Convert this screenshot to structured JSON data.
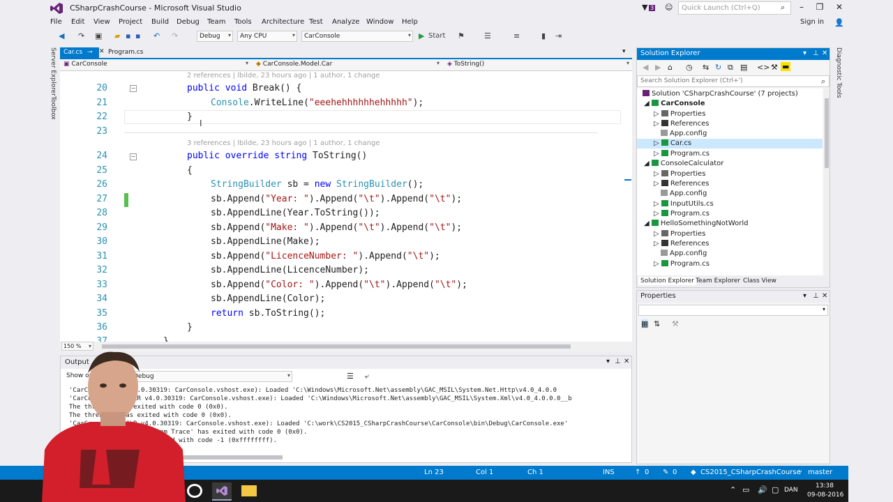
{
  "window": {
    "title": "CSharpCrashCourse - Microsoft Visual Studio",
    "notifications": "3",
    "quick_launch_placeholder": "Quick Launch (Ctrl+Q)",
    "signin": "Sign in"
  },
  "menu": [
    "File",
    "Edit",
    "View",
    "Project",
    "Build",
    "Debug",
    "Team",
    "Tools",
    "Architecture",
    "Test",
    "Analyze",
    "Window",
    "Help"
  ],
  "toolbar": {
    "config": "Debug",
    "platform": "Any CPU",
    "project": "CarConsole",
    "start": "Start"
  },
  "side_left": [
    "Server Explorer",
    "Toolbox"
  ],
  "side_right": [
    "Diagnostic Tools"
  ],
  "editor": {
    "tabs": [
      {
        "label": "Car.cs",
        "active": true
      },
      {
        "label": "Program.cs",
        "active": false
      }
    ],
    "nav": [
      "CarConsole",
      "CarConsole.Model.Car",
      "ToString()"
    ],
    "codelens": [
      "2 references | lbilde, 23 hours ago | 1 author, 1 change",
      "3 references | lbilde, 23 hours ago | 1 author, 1 change"
    ],
    "lines": [
      {
        "n": "20",
        "code": "public void Break() {"
      },
      {
        "n": "21",
        "code": "Console.WriteLine(\"eeehehhhhhhehhhhh\");"
      },
      {
        "n": "22",
        "code": "}"
      },
      {
        "n": "23",
        "code": ""
      },
      {
        "n": "24",
        "code": "public override string ToString()"
      },
      {
        "n": "25",
        "code": "{"
      },
      {
        "n": "26",
        "code": "StringBuilder sb = new StringBuilder();"
      },
      {
        "n": "27",
        "code": "sb.Append(\"Year: \").Append(\"\\t\").Append(\"\\t\");"
      },
      {
        "n": "28",
        "code": "sb.AppendLine(Year.ToString());"
      },
      {
        "n": "29",
        "code": "sb.Append(\"Make: \").Append(\"\\t\").Append(\"\\t\");"
      },
      {
        "n": "30",
        "code": "sb.AppendLine(Make);"
      },
      {
        "n": "31",
        "code": "sb.Append(\"LicenceNumber: \").Append(\"\\t\");"
      },
      {
        "n": "32",
        "code": "sb.AppendLine(LicenceNumber);"
      },
      {
        "n": "33",
        "code": "sb.Append(\"Color: \").Append(\"\\t\").Append(\"\\t\");"
      },
      {
        "n": "34",
        "code": "sb.AppendLine(Color);"
      },
      {
        "n": "35",
        "code": "return sb.ToString();"
      },
      {
        "n": "36",
        "code": "}"
      },
      {
        "n": "37",
        "code": "}"
      }
    ],
    "zoom": "150 %"
  },
  "output": {
    "title": "Output",
    "show_from_label": "Show output from:",
    "show_from_value": "Debug",
    "lines": [
      "'CarCon... (CLR v4.0.30319: CarConsole.vshost.exe): Loaded 'C:\\Windows\\Microsoft.Net\\assembly\\GAC_MSIL\\System.Net.Http\\v4.0_4.0.0",
      "'CarCon...exe' (CLR v4.0.30319: CarConsole.vshost.exe): Loaded 'C:\\Windows\\Microsoft.Net\\assembly\\GAC_MSIL\\System.Xml\\v4.0_4.0.0.0__b",
      "The thre...8 has exited with code 0 (0x0).",
      "The threa...8 has exited with code 0 (0x0).",
      "'CarCo...exe' (CLR v4.0.30319: CarConsole.vshost.exe): Loaded 'C:\\work\\CS2015_CSharpCrashCourse\\CarConsole\\bin\\Debug\\CarConsole.exe'",
      "...ole.vshost.exe: Program Trace' has exited with code 0 (0x0).",
      "...le.vshost.exe' has exited with code -1 (0xffffffff)."
    ]
  },
  "solution_explorer": {
    "title": "Solution Explorer",
    "search_placeholder": "Search Solution Explorer (Ctrl+')",
    "items": [
      {
        "label": "Solution 'CSharpCrashCourse' (7 projects)",
        "indent": 0,
        "bold": false
      },
      {
        "label": "CarConsole",
        "indent": 1,
        "bold": true
      },
      {
        "label": "Properties",
        "indent": 2,
        "bold": false
      },
      {
        "label": "References",
        "indent": 2,
        "bold": false
      },
      {
        "label": "App.config",
        "indent": 2,
        "bold": false
      },
      {
        "label": "Car.cs",
        "indent": 2,
        "bold": false,
        "selected": true
      },
      {
        "label": "Program.cs",
        "indent": 2,
        "bold": false
      },
      {
        "label": "ConsoleCalculator",
        "indent": 1,
        "bold": false
      },
      {
        "label": "Properties",
        "indent": 2,
        "bold": false
      },
      {
        "label": "References",
        "indent": 2,
        "bold": false
      },
      {
        "label": "App.config",
        "indent": 2,
        "bold": false
      },
      {
        "label": "InputUtils.cs",
        "indent": 2,
        "bold": false
      },
      {
        "label": "Program.cs",
        "indent": 2,
        "bold": false
      },
      {
        "label": "HelloSomethingNotWorld",
        "indent": 1,
        "bold": false
      },
      {
        "label": "Properties",
        "indent": 2,
        "bold": false
      },
      {
        "label": "References",
        "indent": 2,
        "bold": false
      },
      {
        "label": "App.config",
        "indent": 2,
        "bold": false
      },
      {
        "label": "Program.cs",
        "indent": 2,
        "bold": false
      }
    ],
    "bottom_tabs": [
      "Solution Explorer",
      "Team Explorer",
      "Class View"
    ]
  },
  "properties": {
    "title": "Properties"
  },
  "status": {
    "ln": "Ln 23",
    "col": "Col 1",
    "ch": "Ch 1",
    "ins": "INS",
    "up": "0",
    "pencil": "0",
    "repo": "CS2015_CSharpCrashCourse",
    "branch": "master"
  },
  "taskbar": {
    "lang": "DAN",
    "time": "13:38",
    "date": "09-08-2016"
  },
  "colors": {
    "accent": "#007acc",
    "keyword": "#0000ff",
    "type": "#2b91af",
    "string": "#a31515"
  }
}
